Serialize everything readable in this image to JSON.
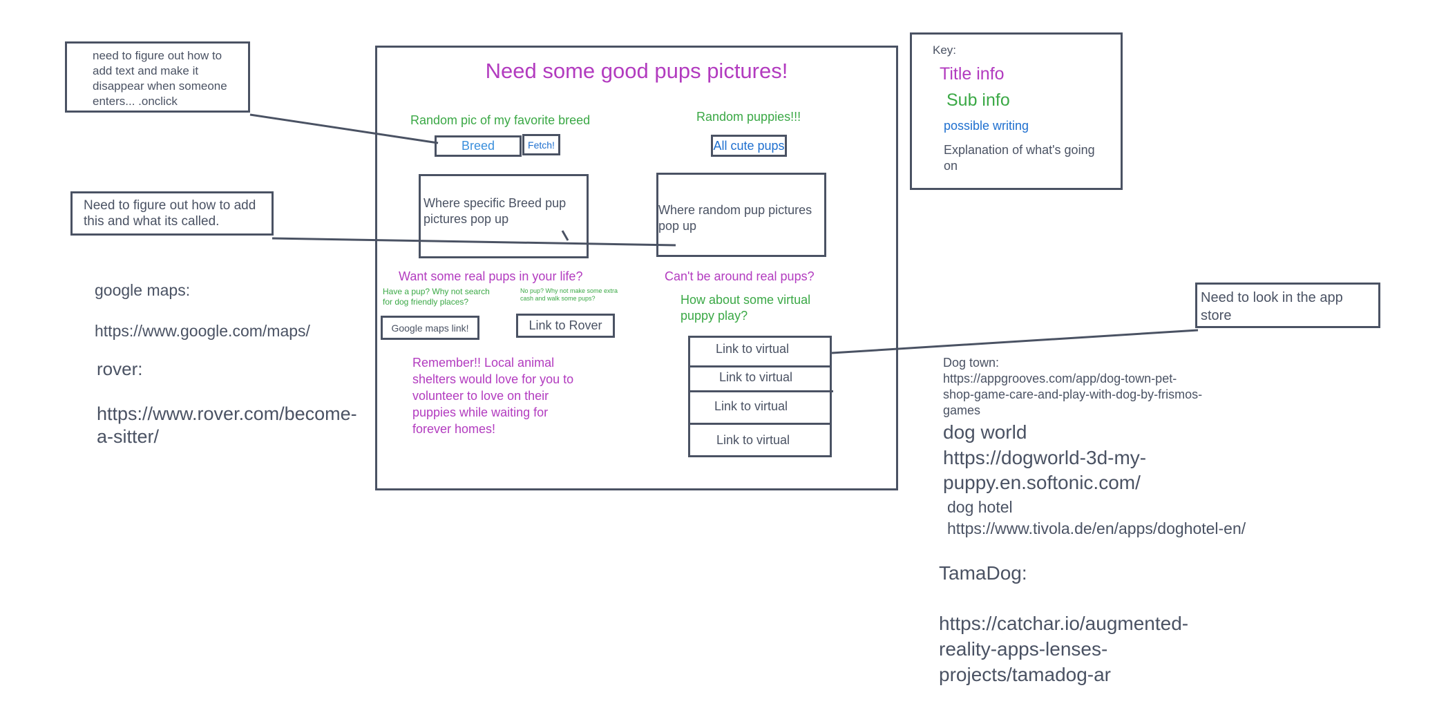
{
  "wireframe": {
    "title": "Need some good pups pictures!",
    "breed_heading": "Random pic of my favorite breed",
    "breed_input_placeholder": "Breed",
    "fetch_button": "Fetch!",
    "random_heading": "Random puppies!!!",
    "all_cute_button": "All cute pups",
    "breed_pics_box": "Where specific Breed pup pictures pop up",
    "random_pics_box": "Where random pup pictures pop up",
    "real_pups_heading": "Want some real pups in your life?",
    "have_pup_text": "Have a pup? Why not search for dog friendly places?",
    "no_pup_text": "No pup? Why not make some extra cash and walk some pups?",
    "google_maps_button": "Google maps link!",
    "rover_button": "Link to Rover",
    "remember_text": "Remember!! Local animal shelters would love for you to volunteer to love on their puppies while waiting for forever homes!",
    "cant_be_around": "Can't be around real pups?",
    "virtual_play": "How about some virtual puppy play?",
    "virtual_links": [
      "Link to virtual",
      "Link to virtual",
      "Link to virtual",
      "Link to virtual"
    ]
  },
  "notes": {
    "onclick_note": "need to figure out how to add text and make it disappear when someone enters... .onclick",
    "add_this_note": "Need to figure out how to add this and what its called.",
    "app_store_note": "Need to look in the app store"
  },
  "key": {
    "label": "Key:",
    "title_info": "Title info",
    "sub_info": "Sub info",
    "possible_writing": "possible writing",
    "explanation": "Explanation of what's going on"
  },
  "left_links": {
    "google_maps_label": "google maps:",
    "google_maps_url": "https://www.google.com/maps/",
    "rover_label": "rover:",
    "rover_url": "https://www.rover.com/become-a-sitter/"
  },
  "right_links": {
    "dog_town_label": "Dog town:",
    "dog_town_url": "https://appgrooves.com/app/dog-town-pet-shop-game-care-and-play-with-dog-by-frismos-games",
    "dog_world_label": "dog world",
    "dog_world_url": "https://dogworld-3d-my-puppy.en.softonic.com/",
    "dog_hotel_label": "dog hotel",
    "dog_hotel_url": "https://www.tivola.de/en/apps/doghotel-en/",
    "tamadog_label": "TamaDog:",
    "tamadog_url": "https://catchar.io/augmented-reality-apps-lenses-projects/tamadog-ar"
  },
  "colors": {
    "title": "#b23bbf",
    "sub": "#3aa845",
    "writing": "#1e6fcf",
    "explanation": "#4a5263"
  }
}
